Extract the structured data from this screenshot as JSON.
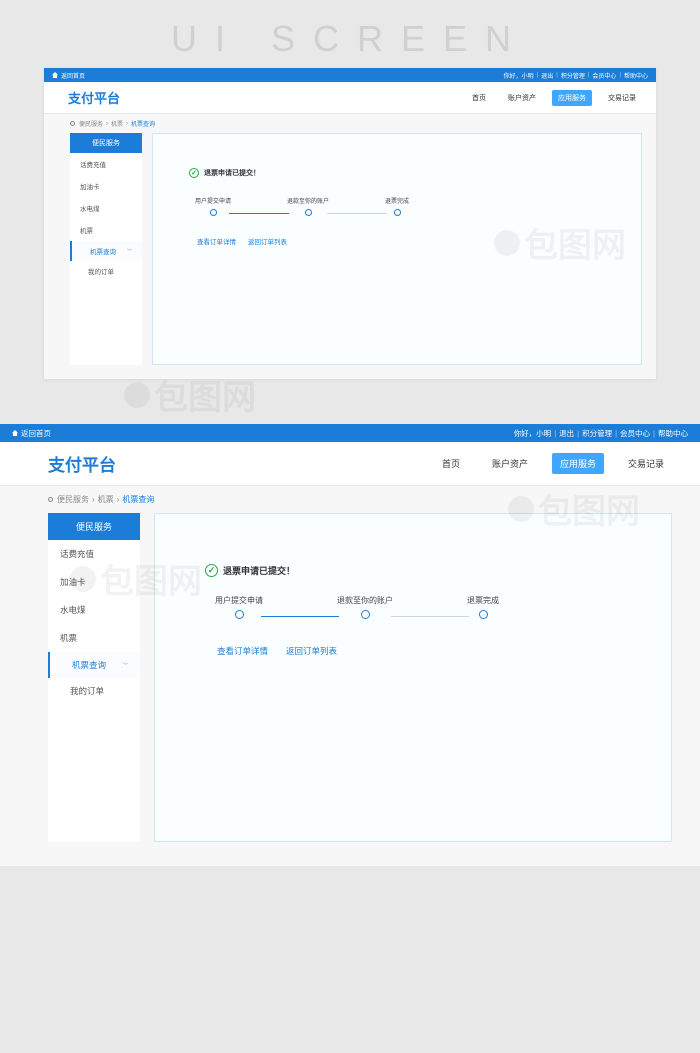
{
  "page_heading": "UI SCREEN",
  "topbar": {
    "home": "返回首页",
    "greeting": "你好，小明",
    "logout": "退出",
    "links": [
      "积分管理",
      "会员中心",
      "帮助中心"
    ]
  },
  "brand": "支付平台",
  "nav": {
    "items": [
      "首页",
      "账户资产",
      "应用服务",
      "交易记录"
    ],
    "active_index": 2
  },
  "breadcrumb": {
    "a": "便民服务",
    "b": "机票",
    "c": "机票查询"
  },
  "sidebar": {
    "head": "便民服务",
    "items": [
      "话费充值",
      "加油卡",
      "水电煤",
      "机票"
    ],
    "sub_active": "机票查询",
    "sub_other": "我的订单"
  },
  "panel": {
    "status": "退票申请已提交！",
    "steps": [
      "用户提交申请",
      "退款至你的账户",
      "退票完成"
    ],
    "link1": "查看订单详情",
    "link2": "返回订单列表"
  },
  "watermark": "包图网"
}
